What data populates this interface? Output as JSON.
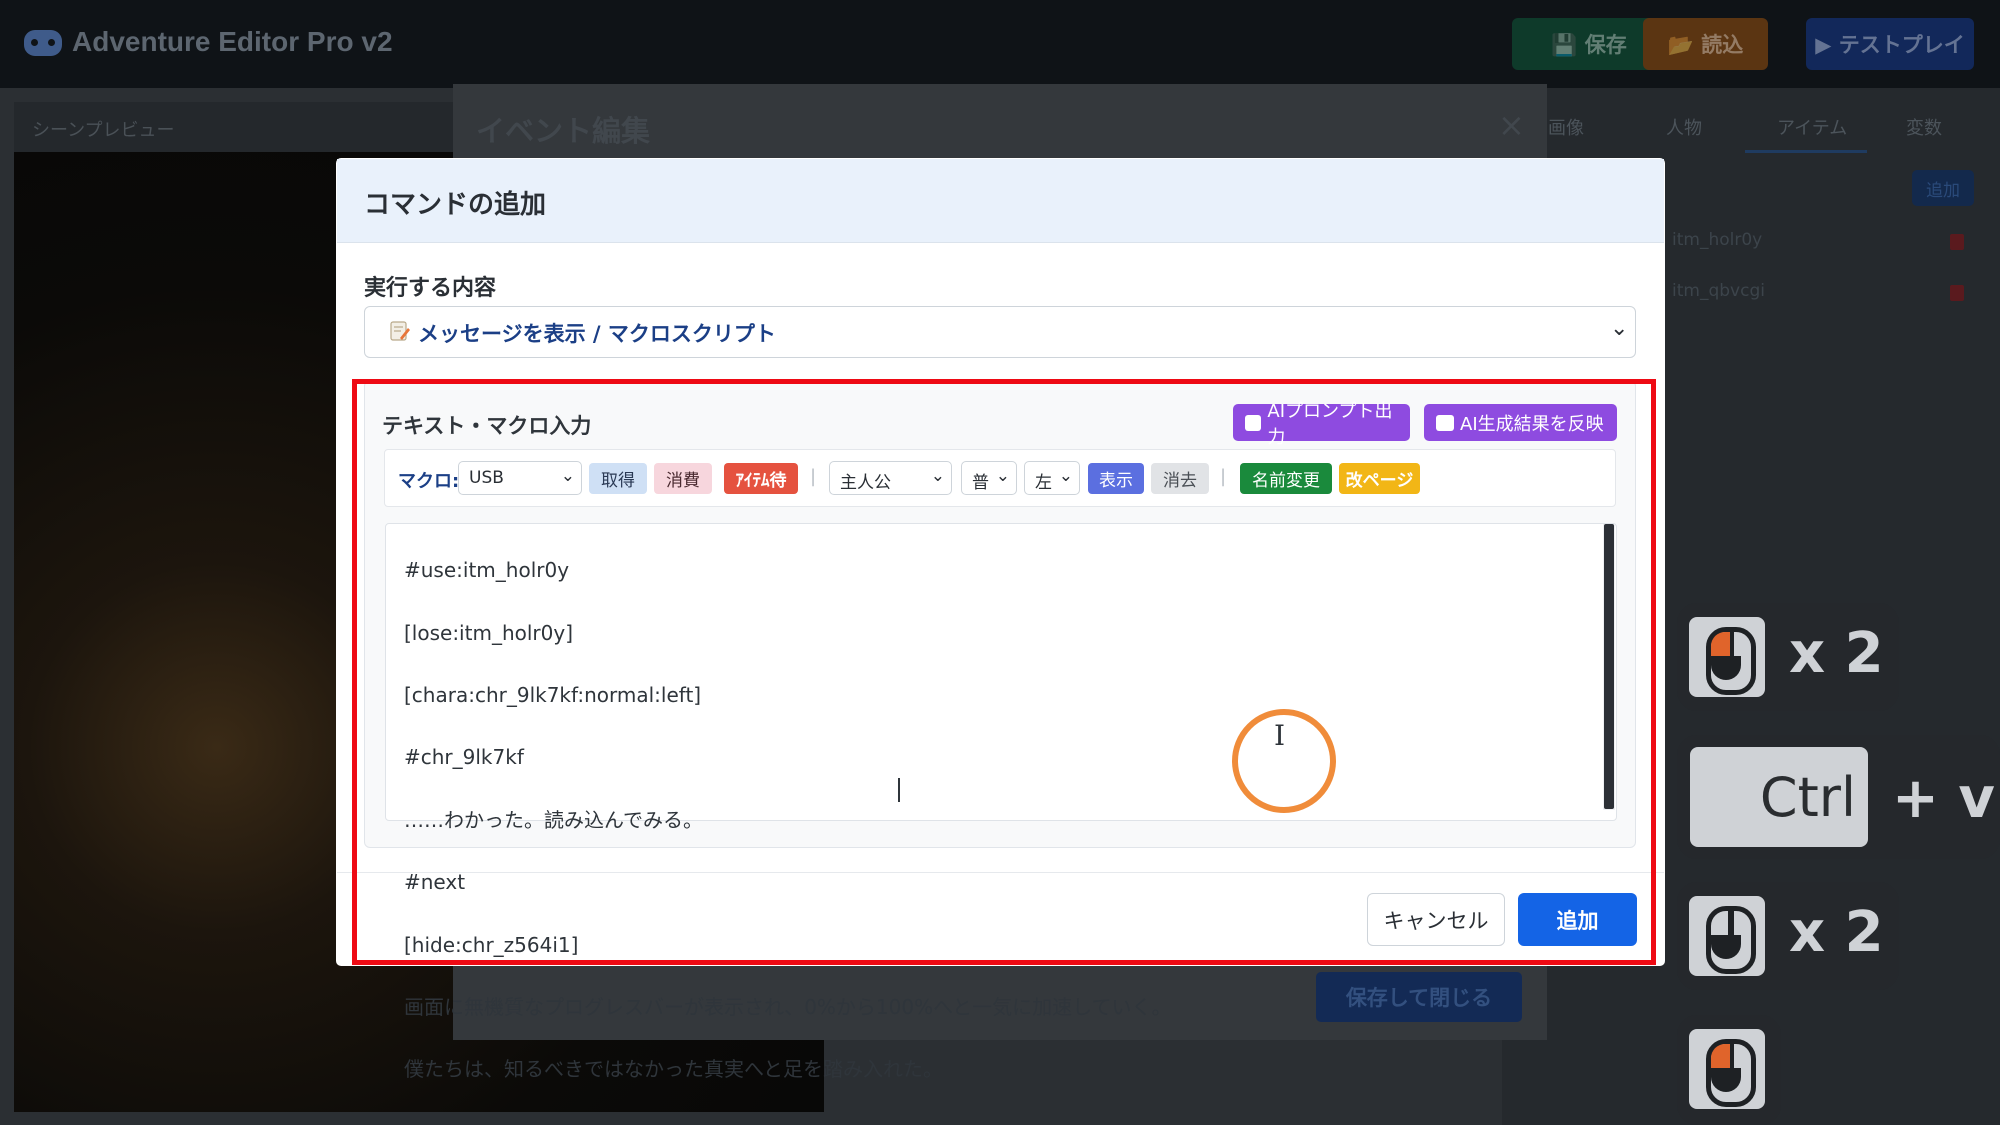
{
  "app": {
    "title": "Adventure Editor Pro v2",
    "header_buttons": {
      "save": "💾 保存",
      "load": "📂 読込",
      "test_play": "▶ テストプレイ"
    }
  },
  "preview": {
    "title": "シーンプレビュー"
  },
  "right_panel": {
    "tabs": [
      "画像",
      "人物",
      "アイテム",
      "変数"
    ],
    "active_tab": "アイテム",
    "add_label": "追加",
    "items": [
      "itm_holr0y",
      "itm_qbvcgi"
    ]
  },
  "event_modal": {
    "title": "イベント編集",
    "close": "×",
    "save_close": "保存して閉じる"
  },
  "command_modal": {
    "title": "コマンドの追加",
    "exec_label": "実行する内容",
    "exec_value": "メッセージを表示 / マクロスクリプト",
    "editor_label": "テキスト・マクロ入力",
    "ai_prompt_button": "AIプロンプト出力",
    "ai_apply_button": "AI生成結果を反映",
    "macro": {
      "label": "マクロ:",
      "item_select": "USB",
      "get": "取得",
      "consume": "消費",
      "item_wait": "ｱｲﾃﾑ待",
      "character_select": "主人公",
      "expression_select": "普",
      "position_select": "左",
      "show": "表示",
      "hide": "消去",
      "rename": "名前変更",
      "page_break": "改ページ",
      "separator": "|"
    },
    "script_lines": [
      "#use:itm_holr0y",
      "[lose:itm_holr0y]",
      "[chara:chr_9lk7kf:normal:left]",
      "#chr_9lk7kf",
      "……わかった。読み込んでみる。",
      "#next",
      "[hide:chr_z564i1]",
      "画面に無機質なプログレスバーが表示され、0%から100%へと一気に加速していく。",
      "僕たちは、知るべきではなかった真実へと足を踏み入れた。"
    ],
    "cancel_button": "キャンセル",
    "add_button": "追加"
  },
  "input_overlay": {
    "double_click_1": "x 2",
    "ctrl_key": "Ctrl",
    "paste_suffix": "+ v",
    "double_click_2": "x 2"
  },
  "colors": {
    "primary": "#1464e6",
    "ai_purple": "#8e4be0",
    "highlight_red": "#ee0a14",
    "click_ring": "#f08c3a"
  }
}
